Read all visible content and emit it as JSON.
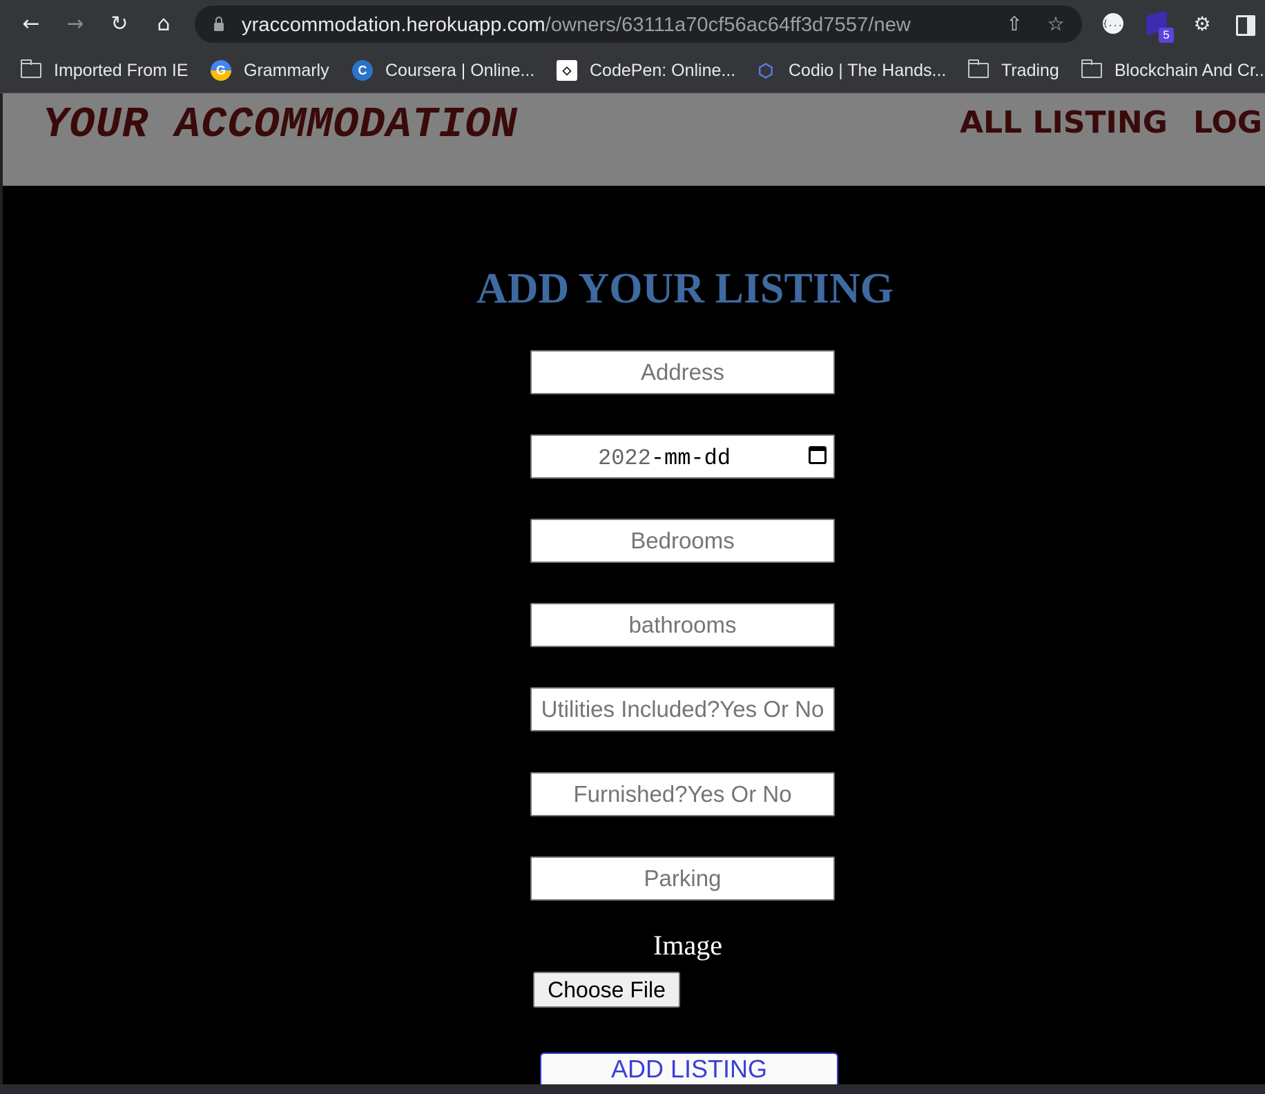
{
  "browser": {
    "url_host": "yraccommodation.herokuapp.com",
    "url_path": "/owners/63111a70cf56ac64ff3d7557/new",
    "extension_badge": "5",
    "bookmarks": [
      {
        "label": "Imported From IE",
        "icon": "folder-icon"
      },
      {
        "label": "Grammarly",
        "icon": "grammarly-icon"
      },
      {
        "label": "Coursera | Online...",
        "icon": "coursera-icon"
      },
      {
        "label": "CodePen: Online...",
        "icon": "codepen-icon"
      },
      {
        "label": "Codio | The Hands...",
        "icon": "codio-icon"
      },
      {
        "label": "Trading",
        "icon": "folder-icon"
      },
      {
        "label": "Blockchain And Cr...",
        "icon": "folder-icon"
      }
    ]
  },
  "site": {
    "logo": "YOUR ACCOMMODATION",
    "nav": {
      "all_listing": "ALL LISTING",
      "log": "LOG O"
    },
    "colors": {
      "header_bg": "#808080",
      "header_text": "#3a0a0a",
      "title": "#3f6aa1",
      "submit": "#3a3fd6"
    }
  },
  "form": {
    "title": "ADD YOUR LISTING",
    "address_placeholder": "Address",
    "date_year": "2022",
    "date_rest": "-mm-dd",
    "bedrooms_placeholder": "Bedrooms",
    "bathrooms_placeholder": "bathrooms",
    "utilities_placeholder": "Utilities Included?Yes Or No",
    "furnished_placeholder": "Furnished?Yes Or No",
    "parking_placeholder": "Parking",
    "image_label": "Image",
    "choose_file_label": "Choose File",
    "submit_label": "ADD LISTING"
  }
}
